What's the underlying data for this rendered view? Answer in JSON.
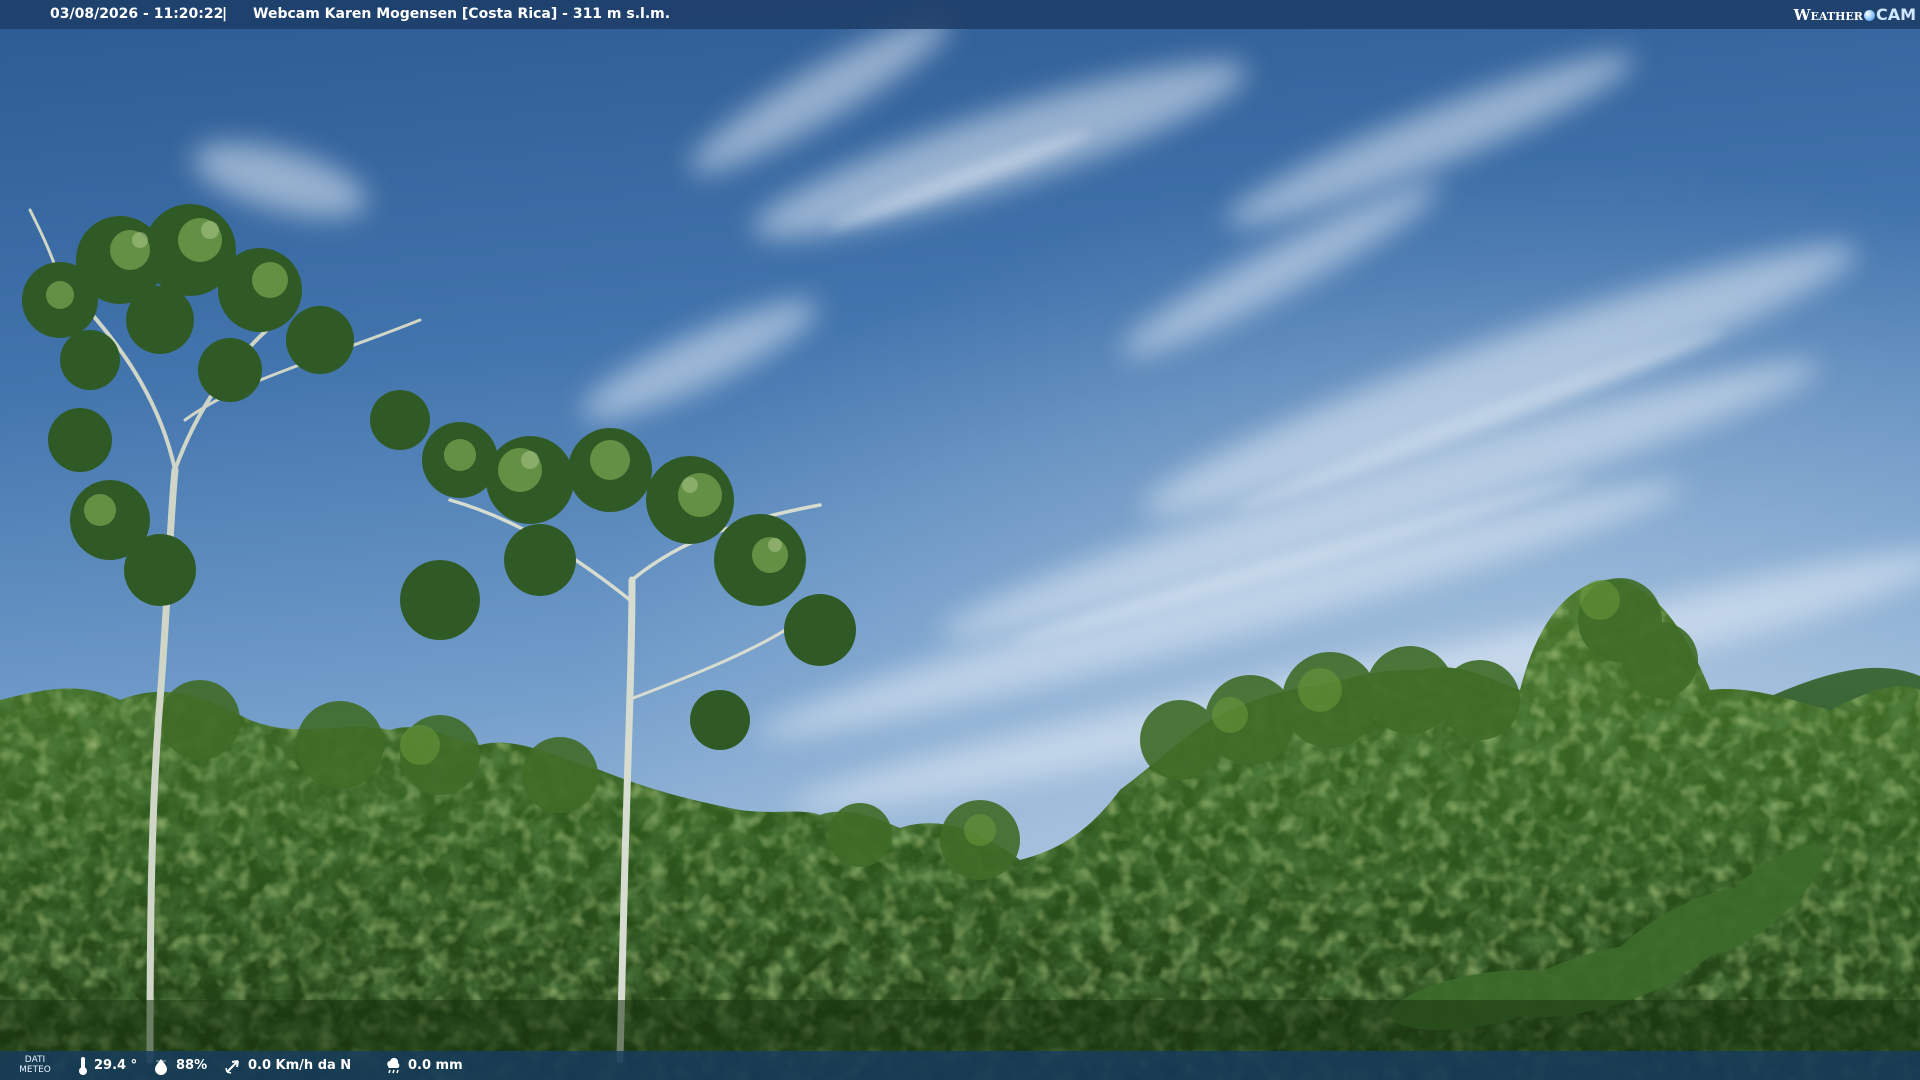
{
  "header": {
    "datetime": "03/08/2026 - 11:20:22",
    "separator": "|",
    "title": "Webcam Karen Mogensen [Costa Rica] - 311 m s.l.m."
  },
  "brand": {
    "part1": "Weather",
    "part2": "CAM"
  },
  "weather": {
    "label_line1": "DATI",
    "label_line2": "METEO",
    "temperature": "29.4 °",
    "humidity": "88%",
    "wind": "0.0 Km/h da N",
    "rain": "0.0 mm"
  },
  "icons": {
    "temperature": "thermometer-icon",
    "humidity": "water-drop-icon",
    "wind": "wind-arrow-icon",
    "rain": "rain-cloud-icon",
    "brand": "globe-icon"
  },
  "colors": {
    "sky_top": "#2f5e96",
    "sky_horizon": "#8fb4d8",
    "forest_dark": "#1f3d17",
    "forest_light": "#5e8b35",
    "bar_background": "#1e3e68"
  }
}
